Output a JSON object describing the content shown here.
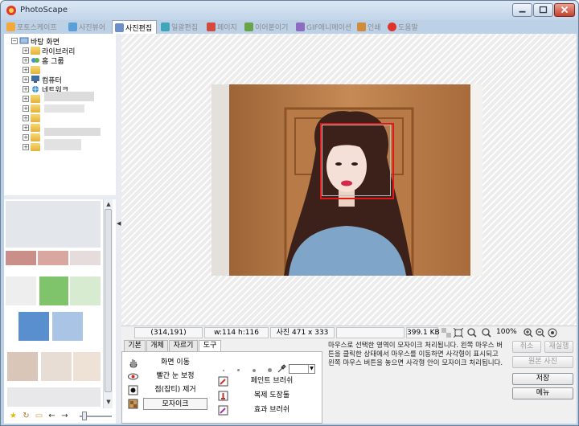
{
  "window": {
    "title": "PhotoScape"
  },
  "tabs": [
    {
      "label": "포토스케이프",
      "active": false
    },
    {
      "label": "사진뷰어",
      "active": false
    },
    {
      "label": "사진편집",
      "active": true
    },
    {
      "label": "일괄편집",
      "active": false
    },
    {
      "label": "페이지",
      "active": false
    },
    {
      "label": "이어붙이기",
      "active": false
    },
    {
      "label": "GIF애니메이션",
      "active": false
    },
    {
      "label": "인쇄",
      "active": false
    },
    {
      "label": "도움말",
      "active": false
    }
  ],
  "tree": {
    "root": "바탕 화면",
    "items": [
      "라이브러리",
      "홈 그룹",
      "",
      "컴퓨터",
      "네트워크"
    ]
  },
  "status": {
    "coords": "(314,191)",
    "selection": "w:114 h:116",
    "photo_size": "사진 471 x 333",
    "file_size": "399.1 KB",
    "zoom": "100%"
  },
  "panel": {
    "tabs": [
      {
        "label": "기본",
        "active": false
      },
      {
        "label": "개체",
        "active": false
      },
      {
        "label": "자르기",
        "active": false
      },
      {
        "label": "도구",
        "active": true
      }
    ],
    "tools_left": [
      {
        "label": "화면 이동",
        "icon": "hand-icon",
        "selected": false
      },
      {
        "label": "빨간 눈 보정",
        "icon": "red-eye-icon",
        "selected": false
      },
      {
        "label": "점(잡티) 제거",
        "icon": "spot-icon",
        "selected": false
      },
      {
        "label": "모자이크",
        "icon": "mosaic-icon",
        "selected": true
      }
    ],
    "tools_right": [
      {
        "label": "페인트 브러쉬",
        "icon": "paint-brush-icon"
      },
      {
        "label": "복제 도장툴",
        "icon": "clone-stamp-icon"
      },
      {
        "label": "효과 브러쉬",
        "icon": "effect-brush-icon"
      }
    ],
    "description": "마우스로 선택한 영역이 모자이크 처리됩니다. 왼쪽 마우스 버튼을 클릭한 상태에서 마우스를 이동하면 사각형이 표시되고 왼쪽 마우스 버튼을 놓으면 사각형 안이 모자이크 처리됩니다."
  },
  "buttons": {
    "undo": "취소",
    "redo": "재실행",
    "original": "원본 사진",
    "save": "저장",
    "menu": "메뉴"
  },
  "colors": {
    "accent": "#e01818",
    "window_frame": "#bcd0e6"
  }
}
